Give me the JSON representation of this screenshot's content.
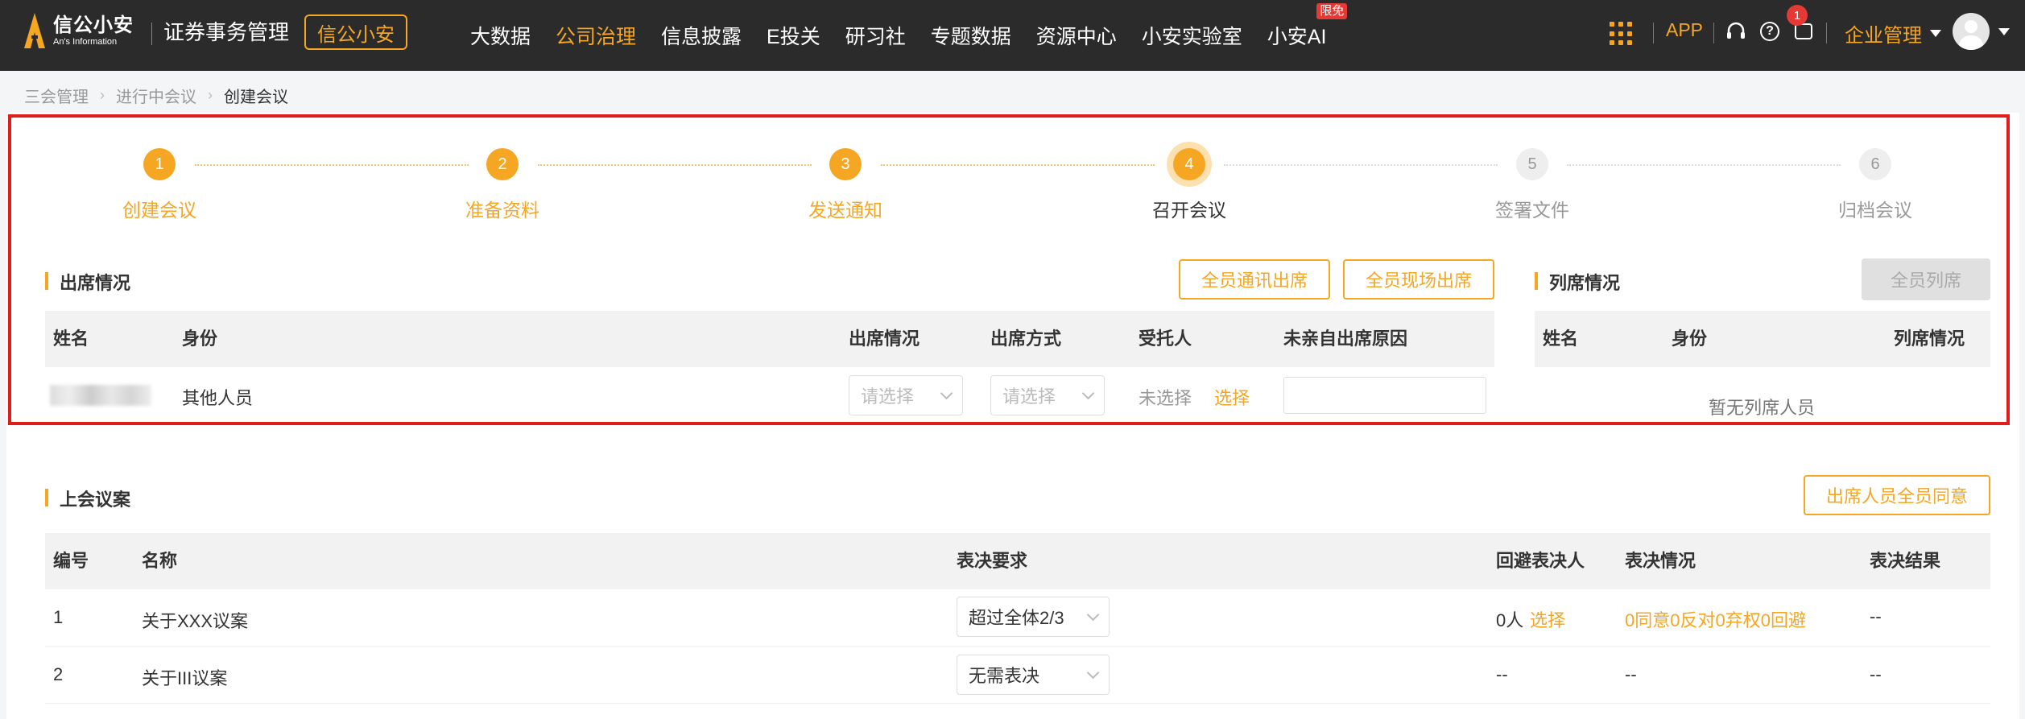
{
  "header": {
    "logo_name": "信公小安",
    "logo_sub": "An's Information",
    "app_title": "证券事务管理",
    "brand_button": "信公小安",
    "nav": [
      {
        "label": "大数据",
        "active": false
      },
      {
        "label": "公司治理",
        "active": true
      },
      {
        "label": "信息披露",
        "active": false
      },
      {
        "label": "E投关",
        "active": false
      },
      {
        "label": "研习社",
        "active": false
      },
      {
        "label": "专题数据",
        "active": false
      },
      {
        "label": "资源中心",
        "active": false
      },
      {
        "label": "小安实验室",
        "active": false
      },
      {
        "label": "小安AI",
        "active": false,
        "badge": "限免"
      }
    ],
    "app_label": "APP",
    "help_glyph": "?",
    "message_count": "1",
    "enterprise_label": "企业管理"
  },
  "breadcrumb": [
    "三会管理",
    "进行中会议",
    "创建会议"
  ],
  "steps": [
    {
      "num": "1",
      "label": "创建会议",
      "state": "done"
    },
    {
      "num": "2",
      "label": "准备资料",
      "state": "done"
    },
    {
      "num": "3",
      "label": "发送通知",
      "state": "done"
    },
    {
      "num": "4",
      "label": "召开会议",
      "state": "current"
    },
    {
      "num": "5",
      "label": "签署文件",
      "state": "future"
    },
    {
      "num": "6",
      "label": "归档会议",
      "state": "future"
    }
  ],
  "attendance": {
    "title": "出席情况",
    "btn_comm": "全员通讯出席",
    "btn_onsite": "全员现场出席",
    "columns": [
      "姓名",
      "身份",
      "出席情况",
      "出席方式",
      "受托人",
      "未亲自出席原因"
    ],
    "row": {
      "role": "其他人员",
      "status_placeholder": "请选择",
      "mode_placeholder": "请选择",
      "proxy": "未选择",
      "proxy_action": "选择"
    }
  },
  "observers": {
    "title": "列席情况",
    "btn_all": "全员列席",
    "columns": [
      "姓名",
      "身份",
      "列席情况"
    ],
    "empty": "暂无列席人员"
  },
  "motions": {
    "title": "上会议案",
    "btn_agree": "出席人员全员同意",
    "columns": [
      "编号",
      "名称",
      "表决要求",
      "回避表决人",
      "表决情况",
      "表决结果"
    ],
    "rows": [
      {
        "no": "1",
        "name": "关于XXX议案",
        "requirement": "超过全体2/3",
        "recusal": "0人",
        "recusal_action": "选择",
        "vote": "0同意0反对0弃权0回避",
        "result": "--"
      },
      {
        "no": "2",
        "name": "关于III议案",
        "requirement": "无需表决",
        "recusal": "--",
        "recusal_action": "",
        "vote": "--",
        "result": "--"
      }
    ]
  },
  "colors": {
    "accent": "#f5a623",
    "topbar": "#2b2b2b",
    "highlight": "#e21b1b"
  }
}
